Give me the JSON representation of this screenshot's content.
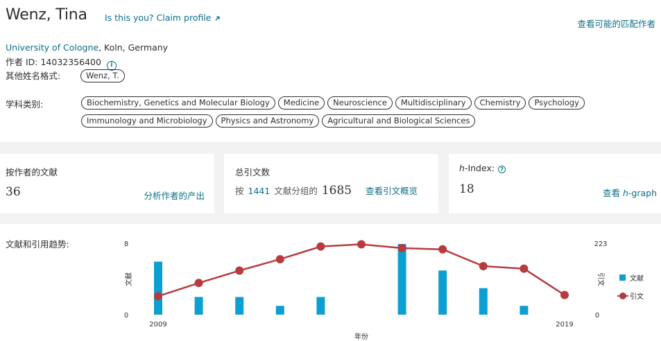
{
  "profile": {
    "name": "Wenz, Tina",
    "claim_link": "Is this you? Claim profile",
    "find_match": "查看可能的匹配作者",
    "affiliation_org": "University of Cologne",
    "affiliation_rest": ", Koln, Germany",
    "author_id": "作者 ID: 14032356400",
    "other_names_label": "其他姓名格式:",
    "other_name": "Wenz, T.",
    "subject_label": "学科类别:",
    "subjects_row1": [
      "Biochemistry, Genetics and Molecular Biology",
      "Medicine",
      "Neuroscience",
      "Multidisciplinary",
      "Chemistry",
      "Psychology"
    ],
    "subjects_row2": [
      "Immunology and Microbiology",
      "Physics and Astronomy",
      "Agricultural and Biological Sciences"
    ]
  },
  "stats": {
    "docs_title": "按作者的文献",
    "docs_count": "36",
    "docs_link": "分析作者的产出",
    "cites_title": "总引文数",
    "cites_prefix": "按",
    "cites_docs": "1441",
    "cites_mid": "文献分组的",
    "cites_total": "1685",
    "cites_link": "查看引文概览",
    "h_title_italic": "h",
    "h_title_rest": "-Index:",
    "h_value": "18",
    "h_link_prefix": "查看 ",
    "h_link_italic": "h",
    "h_link_rest": "-graph"
  },
  "trend": {
    "label": "文献和引用趋势:"
  },
  "colors": {
    "link": "#0b6e8a",
    "bar": "#0c9fd1",
    "line": "#b73a3f"
  },
  "chart_data": {
    "type": "bar+line",
    "x": [
      2009,
      2010,
      2011,
      2012,
      2013,
      2014,
      2015,
      2016,
      2017,
      2018,
      2019
    ],
    "x_tick_labels": [
      "2009",
      "2019"
    ],
    "xlabel": "年份",
    "ylabel_left": "文献",
    "ylabel_right": "引文",
    "ylim_left": [
      0,
      8
    ],
    "ylim_right": [
      0,
      223
    ],
    "left_tick_labels": [
      "8",
      "0"
    ],
    "right_tick_labels": [
      "223",
      "0"
    ],
    "legend_position": "right",
    "series": [
      {
        "name": "文献",
        "type": "bar",
        "axis": "left",
        "values": [
          6,
          2,
          2,
          1,
          2,
          null,
          8,
          5,
          3,
          1,
          null
        ]
      },
      {
        "name": "引文",
        "type": "line",
        "axis": "right",
        "values": [
          58,
          100,
          139,
          175,
          215,
          222,
          210,
          206,
          153,
          145,
          62
        ]
      }
    ]
  }
}
